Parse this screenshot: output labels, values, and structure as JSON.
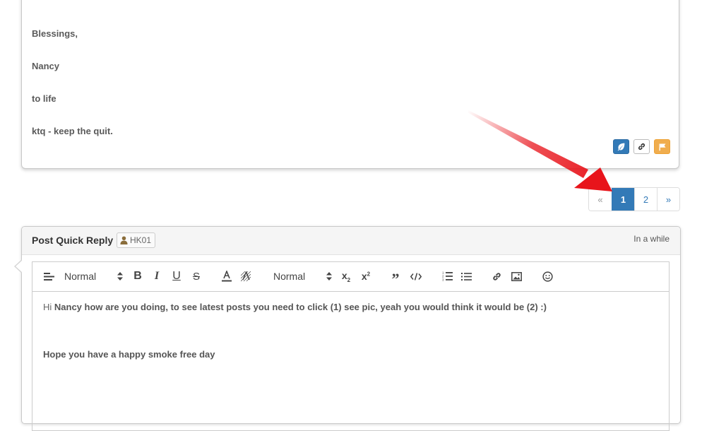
{
  "post": {
    "lines": [
      "Blessings,",
      "Nancy",
      "to life",
      "ktq - keep the quit."
    ],
    "actions": {
      "like_icon": "leaf-icon",
      "link_icon": "link-icon",
      "flag_icon": "flag-icon"
    }
  },
  "pagination": {
    "prev": "«",
    "pages": [
      "1",
      "2"
    ],
    "active_page": "1",
    "next": "»"
  },
  "reply": {
    "title": "Post Quick Reply",
    "user": "HK01",
    "time": "In a while",
    "toolbar": {
      "header_select": "Normal",
      "size_select": "Normal"
    },
    "body": {
      "line1_prefix": "Hi ",
      "line1_name": "Nancy",
      "line1_rest": " how are you doing, to see latest posts you need to click (1) see pic, yeah you would think it would be (2) :)",
      "line2": "Hope you have a happy smoke free day"
    }
  },
  "colors": {
    "primary": "#337ab7",
    "warning": "#f0ad4e",
    "arrow": "#e8141b"
  }
}
